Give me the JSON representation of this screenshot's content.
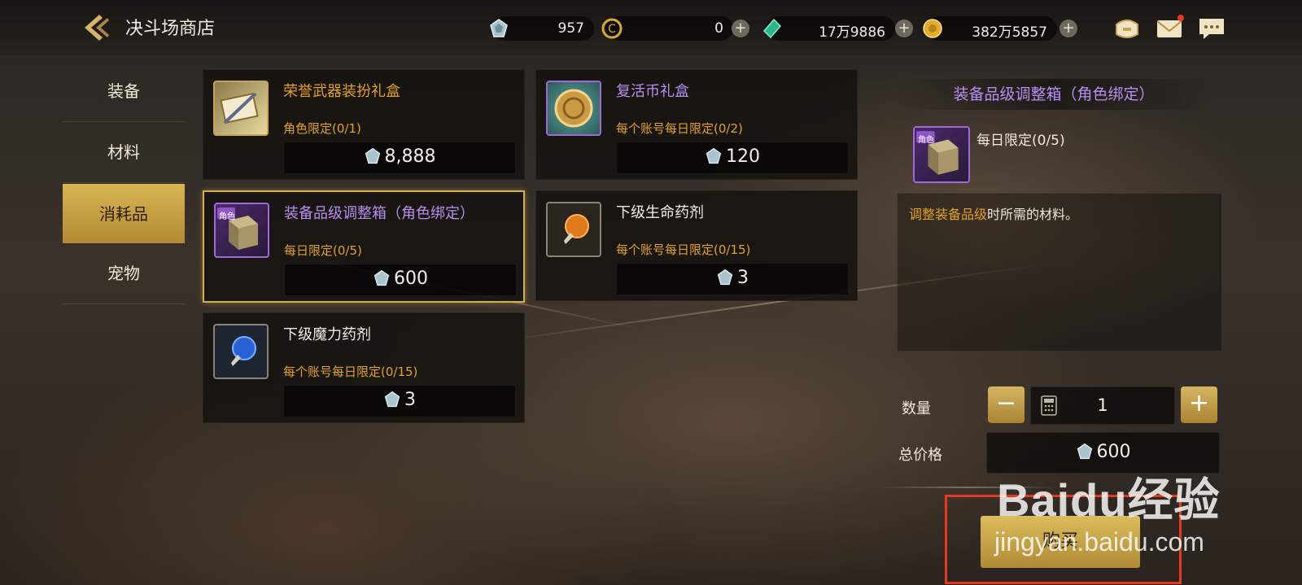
{
  "header": {
    "title": "决斗场商店",
    "currencies": [
      {
        "icon": "duel-crystal-icon",
        "value": "957"
      },
      {
        "icon": "gold-c-coin-icon",
        "value": "0"
      },
      {
        "icon": "green-gem-icon",
        "value": "17万9886"
      },
      {
        "icon": "gold-coin-icon",
        "value": "382万5857"
      }
    ]
  },
  "sidebar": {
    "items": [
      {
        "label": "装备",
        "active": false
      },
      {
        "label": "材料",
        "active": false
      },
      {
        "label": "消耗品",
        "active": true
      },
      {
        "label": "宠物",
        "active": false
      }
    ]
  },
  "shop": {
    "items": [
      {
        "name": "荣誉武器装扮礼盒",
        "name_color": "#e1a227",
        "limit_text": "角色限定(0/1)",
        "price": "8,888",
        "icon": "weapon-chest-icon",
        "selected": false
      },
      {
        "name": "复活币礼盒",
        "name_color": "#b88ef2",
        "limit_text": "每个账号每日限定(0/2)",
        "price": "120",
        "icon": "revive-coin-icon",
        "selected": false
      },
      {
        "name": "装备品级调整箱（角色绑定）",
        "name_color": "#b88ef2",
        "limit_text": "每日限定(0/5)",
        "price": "600",
        "icon": "adjust-box-icon",
        "selected": true,
        "badge": "角色"
      },
      {
        "name": "下级生命药剂",
        "name_color": "#f1ece2",
        "limit_text": "每个账号每日限定(0/15)",
        "price": "3",
        "icon": "hp-potion-icon",
        "selected": false
      },
      {
        "name": "下级魔力药剂",
        "name_color": "#f1ece2",
        "limit_text": "每个账号每日限定(0/15)",
        "price": "3",
        "icon": "mp-potion-icon",
        "selected": false
      }
    ]
  },
  "detail": {
    "title": "装备品级调整箱（角色绑定）",
    "limit_text": "每日限定(0/5)",
    "badge": "角色",
    "description_highlight": "调整装备品级",
    "description_rest": "时所需的材料。",
    "quantity_label": "数量",
    "quantity": "1",
    "total_label": "总价格",
    "total": "600",
    "buy_label": "购买"
  },
  "watermark": {
    "logo": "Baidu经验",
    "url": "jingyan.baidu.com"
  },
  "colors": {
    "gold_accent": "#d4b04a",
    "limit_orange": "#e1a227",
    "purple_name": "#b88ef2",
    "highlight_red": "#e53a22"
  }
}
